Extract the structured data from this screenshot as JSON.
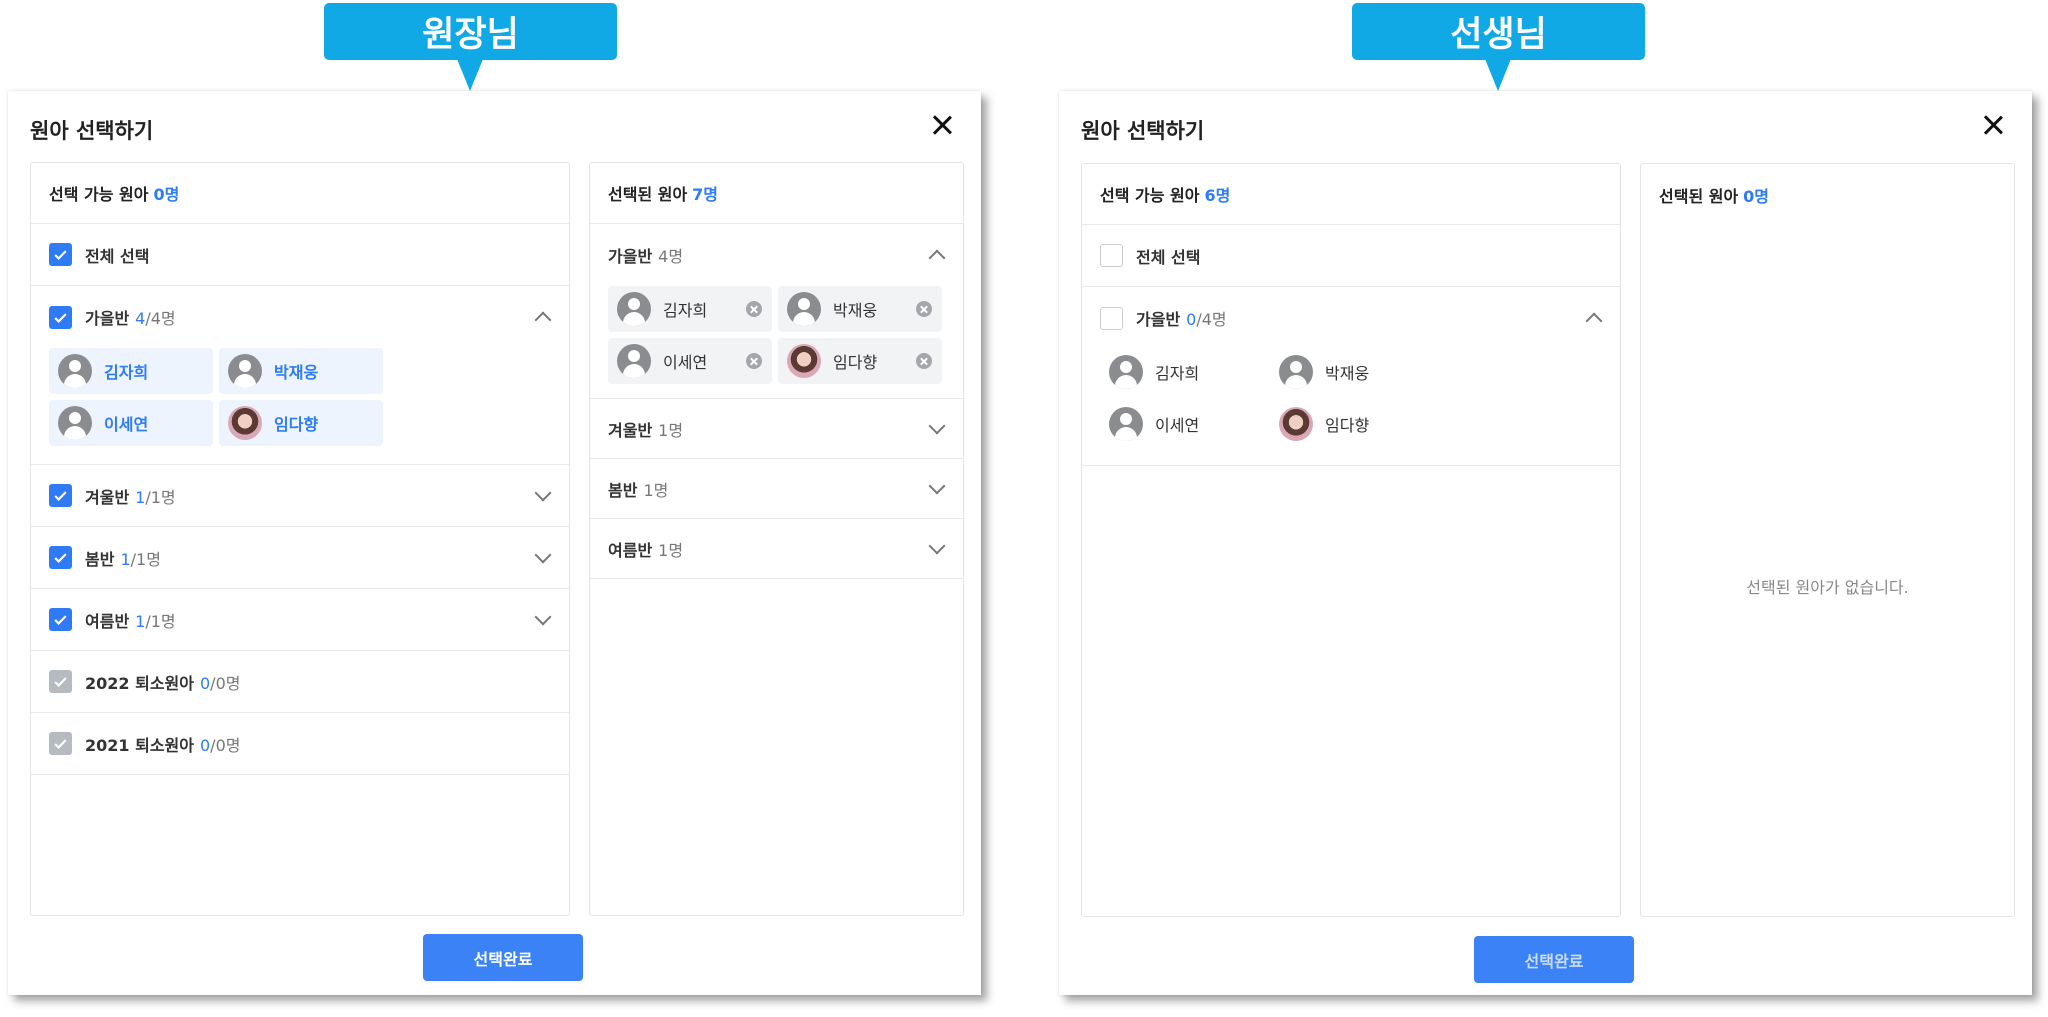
{
  "left": {
    "badge": "원장님",
    "title": "원아 선택하기",
    "available": {
      "label": "선택 가능 원아",
      "count": "0명"
    },
    "select_all": "전체 선택",
    "groups": [
      {
        "label": "가을반",
        "sel": "4",
        "total": "/4명",
        "kids": [
          "김자희",
          "박재웅",
          "이세연",
          "임다향"
        ]
      },
      {
        "label": "겨울반",
        "sel": "1",
        "total": "/1명"
      },
      {
        "label": "봄반",
        "sel": "1",
        "total": "/1명"
      },
      {
        "label": "여름반",
        "sel": "1",
        "total": "/1명"
      },
      {
        "label": "2022 퇴소원아",
        "sel": "0",
        "total": "/0명"
      },
      {
        "label": "2021 퇴소원아",
        "sel": "0",
        "total": "/0명"
      }
    ],
    "selected": {
      "label": "선택된 원아",
      "count": "7명"
    },
    "selected_groups": [
      {
        "label": "가을반",
        "count": "4명",
        "kids": [
          "김자희",
          "박재웅",
          "이세연",
          "임다향"
        ]
      },
      {
        "label": "겨울반",
        "count": "1명"
      },
      {
        "label": "봄반",
        "count": "1명"
      },
      {
        "label": "여름반",
        "count": "1명"
      }
    ],
    "submit": "선택완료"
  },
  "right": {
    "badge": "선생님",
    "title": "원아 선택하기",
    "available": {
      "label": "선택 가능 원아",
      "count": "6명"
    },
    "select_all": "전체 선택",
    "groups": [
      {
        "label": "가을반",
        "sel": "0",
        "total": "/4명",
        "kids": [
          "김자희",
          "박재웅",
          "이세연",
          "임다향"
        ]
      }
    ],
    "selected": {
      "label": "선택된 원아",
      "count": "0명"
    },
    "empty_message": "선택된 원아가 없습니다.",
    "submit": "선택완료"
  },
  "colors": {
    "accent": "#2f7bf6",
    "badge": "#10a8e5",
    "disabled_check": "#b6bac1"
  }
}
